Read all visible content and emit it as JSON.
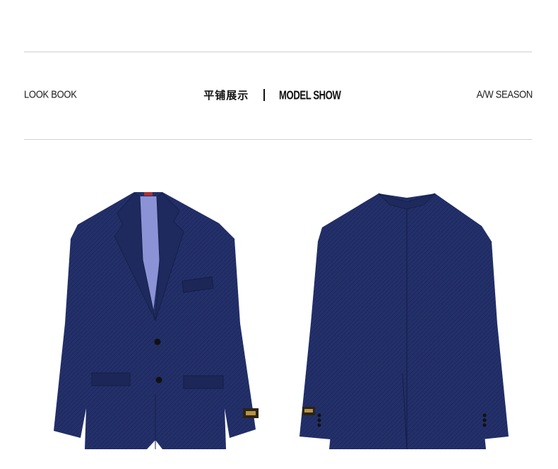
{
  "header": {
    "left_text": "LOOK BOOK",
    "center_cn": "平铺展示",
    "center_en": "MODEL SHOW",
    "right_text": "A/W SEASON"
  },
  "colors": {
    "jacket": "#23306b",
    "jacket_dark": "#1a2452",
    "lining": "#8b93d6",
    "rule": "#cfcfcf"
  },
  "images": [
    {
      "name": "jacket-front",
      "description_icon": "jacket-front-icon"
    },
    {
      "name": "jacket-back",
      "description_icon": "jacket-back-icon"
    }
  ]
}
